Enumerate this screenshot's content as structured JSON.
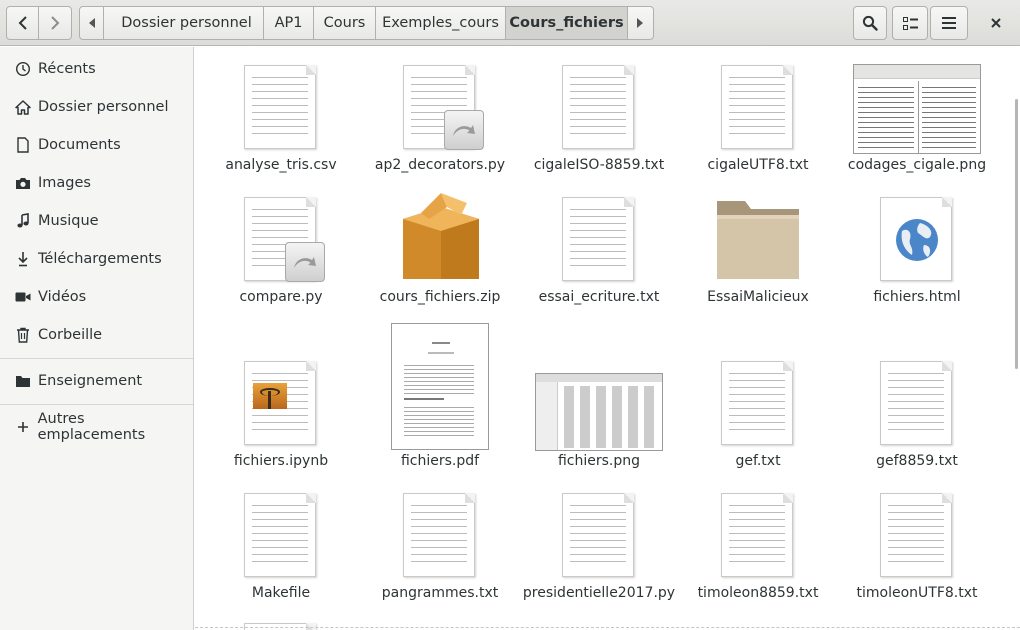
{
  "nav": {
    "back_icon": "chevron-left-icon",
    "forward_icon": "chevron-right-icon"
  },
  "breadcrumb": {
    "items": [
      {
        "label": "Dossier personnel",
        "icon": "home-icon"
      },
      {
        "label": "AP1"
      },
      {
        "label": "Cours"
      },
      {
        "label": "Exemples_cours"
      },
      {
        "label": "Cours_fichiers"
      }
    ]
  },
  "toolbar": {
    "search_icon": "search-icon",
    "view_icon": "list-view-icon",
    "menu_icon": "hamburger-menu-icon",
    "close_icon": "close-icon"
  },
  "sidebar": {
    "items": [
      {
        "label": "Récents",
        "icon": "clock-icon"
      },
      {
        "label": "Dossier personnel",
        "icon": "home-icon"
      },
      {
        "label": "Documents",
        "icon": "document-icon"
      },
      {
        "label": "Images",
        "icon": "camera-icon"
      },
      {
        "label": "Musique",
        "icon": "music-icon"
      },
      {
        "label": "Téléchargements",
        "icon": "download-icon"
      },
      {
        "label": "Vidéos",
        "icon": "video-icon"
      },
      {
        "label": "Corbeille",
        "icon": "trash-icon"
      },
      {
        "label": "Enseignement",
        "icon": "folder-icon"
      },
      {
        "label": "Autres emplacements",
        "icon": "plus-icon"
      }
    ]
  },
  "files": [
    {
      "name": "analyse_tris.csv",
      "type": "text"
    },
    {
      "name": "ap2_decorators.py",
      "type": "script"
    },
    {
      "name": "cigaleISO-8859.txt",
      "type": "text"
    },
    {
      "name": "cigaleUTF8.txt",
      "type": "text"
    },
    {
      "name": "codages_cigale.png",
      "type": "image"
    },
    {
      "name": "compare.py",
      "type": "script"
    },
    {
      "name": "cours_fichiers.zip",
      "type": "archive"
    },
    {
      "name": "essai_ecriture.txt",
      "type": "text"
    },
    {
      "name": "EssaiMalicieux",
      "type": "folder"
    },
    {
      "name": "fichiers.html",
      "type": "html"
    },
    {
      "name": "fichiers.ipynb",
      "type": "notebook"
    },
    {
      "name": "fichiers.pdf",
      "type": "pdf"
    },
    {
      "name": "fichiers.png",
      "type": "image"
    },
    {
      "name": "gef.txt",
      "type": "text"
    },
    {
      "name": "gef8859.txt",
      "type": "text"
    },
    {
      "name": "Makefile",
      "type": "text"
    },
    {
      "name": "pangrammes.txt",
      "type": "text"
    },
    {
      "name": "presidentielle2017.py",
      "type": "text"
    },
    {
      "name": "timoleon8859.txt",
      "type": "text"
    },
    {
      "name": "timoleonUTF8.txt",
      "type": "text"
    }
  ]
}
